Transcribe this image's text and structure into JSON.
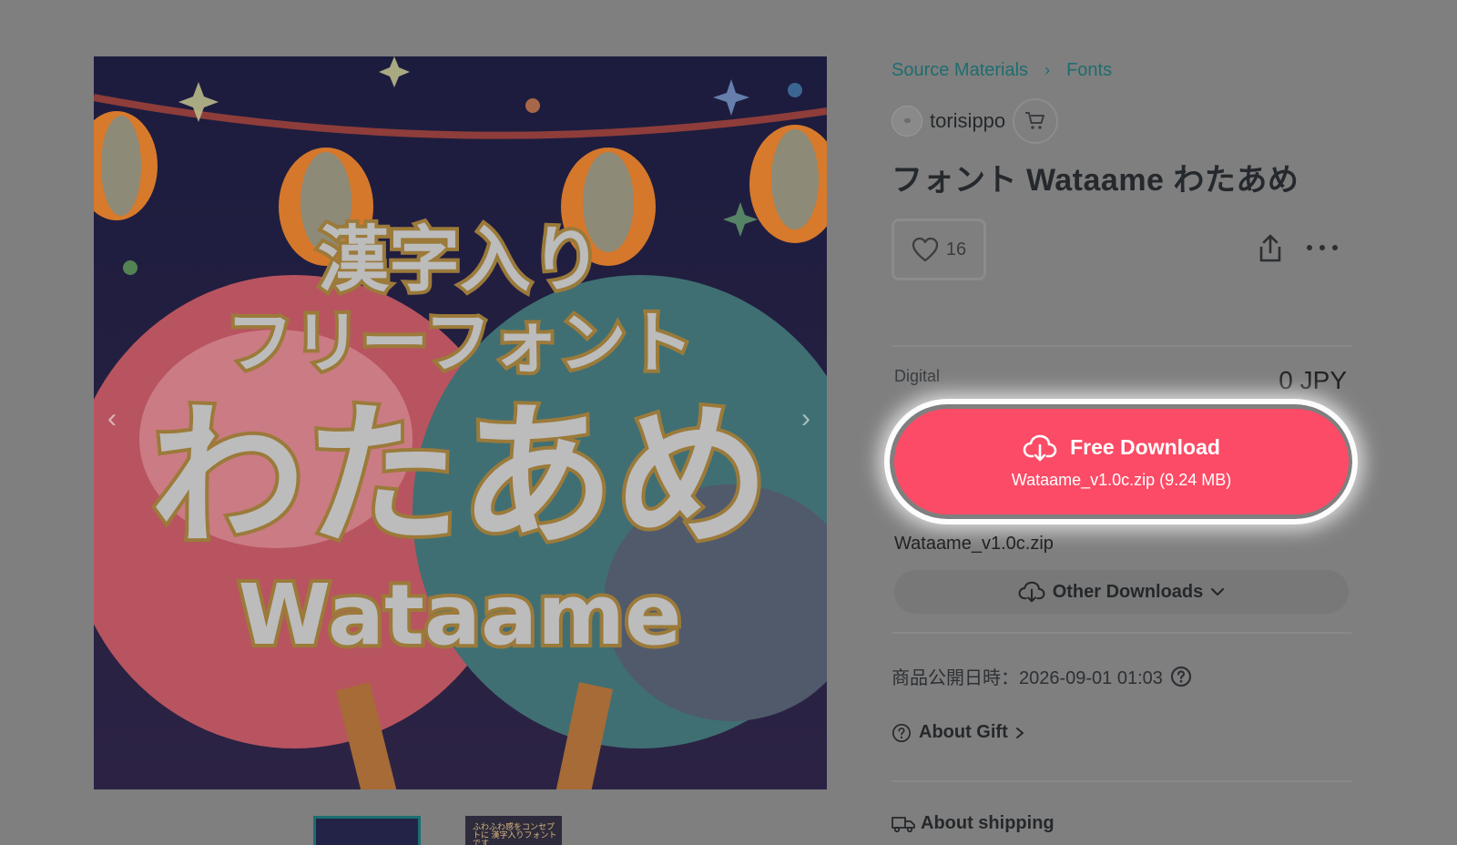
{
  "hero": {
    "text_line1": "漢字入り",
    "text_line2": "フリーフォント",
    "text_line3": "わたあめ",
    "text_line4": "Wataame",
    "prev_glyph": "‹",
    "next_glyph": "›"
  },
  "thumbnails": [
    {
      "selected": true
    },
    {
      "selected": false,
      "caption": "ふわふわ感をコンセプトに 漢字入りフォントです"
    }
  ],
  "breadcrumb": {
    "items": [
      "Source Materials",
      "Fonts"
    ],
    "separator": "›"
  },
  "shop": {
    "name": "torisippo",
    "cart_icon": "cart-icon"
  },
  "product": {
    "title": "フォント Wataame わたあめ",
    "likes": "16"
  },
  "pricing": {
    "type_label": "Digital",
    "price": "0 JPY"
  },
  "download": {
    "label": "Free Download",
    "file_info": "Wataame_v1.0c.zip (9.24 MB)",
    "file_name": "Wataame_v1.0c.zip",
    "other_label": "Other Downloads"
  },
  "meta": {
    "published": "商品公開日時：2026-09-01 01:03"
  },
  "links": {
    "gift": "About Gift",
    "shipping": "About shipping"
  },
  "colors": {
    "accent": "#fc4b66",
    "link": "#1e6d6f",
    "overlay": "#7f7f7f"
  }
}
